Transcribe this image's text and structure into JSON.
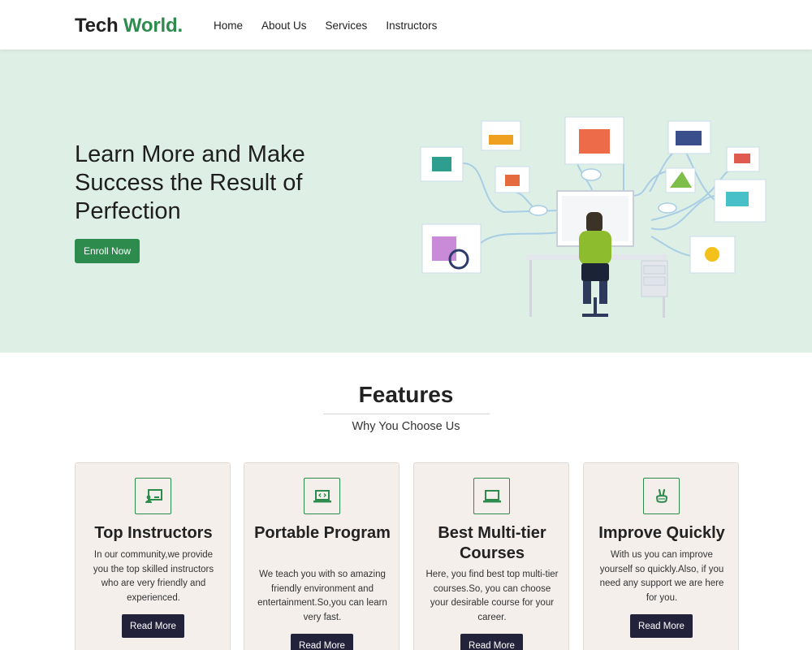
{
  "brand": {
    "part1": "Tech",
    "part2": "World."
  },
  "nav": {
    "items": [
      "Home",
      "About Us",
      "Services",
      "Instructors"
    ]
  },
  "hero": {
    "title": "Learn More and Make Success the Result of Perfection",
    "cta_label": "Enroll Now"
  },
  "features": {
    "title": "Features",
    "subtitle": "Why You Choose Us",
    "cards": [
      {
        "icon": "instructor-icon",
        "title": "Top Instructors",
        "text": "In our community,we provide you the top skilled instructors who are very friendly and experienced.",
        "button": "Read More"
      },
      {
        "icon": "laptop-code-icon",
        "title": "Portable Program",
        "text": "We teach you with so amazing friendly environment and entertainment.So,you can learn very fast.",
        "button": "Read More"
      },
      {
        "icon": "laptop-icon",
        "title": "Best Multi-tier Courses",
        "text": "Here, you find best top multi-tier courses.So, you can choose your desirable course for your career.",
        "button": "Read More"
      },
      {
        "icon": "peace-hand-icon",
        "title": "Improve Quickly",
        "text": "With us you can improve yourself so quickly.Also, if you need any support we are here for you.",
        "button": "Read More"
      }
    ]
  },
  "colors": {
    "accent": "#2e8b4e",
    "hero_bg": "#def0e6",
    "card_bg": "#f5efeb",
    "button_dark": "#22223b"
  }
}
